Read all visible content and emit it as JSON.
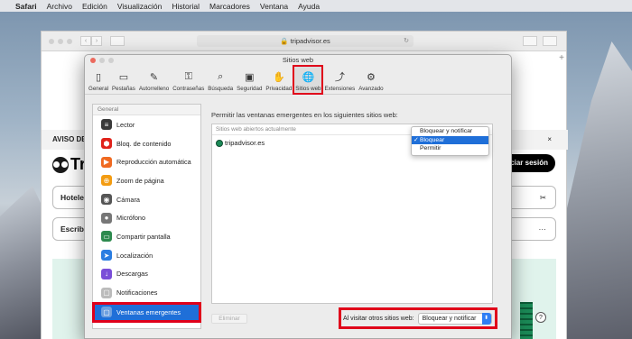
{
  "menubar": {
    "apple": "",
    "items": [
      "Safari",
      "Archivo",
      "Edición",
      "Visualización",
      "Historial",
      "Marcadores",
      "Ventana",
      "Ayuda"
    ]
  },
  "safari": {
    "url": "tripadvisor.es",
    "page": {
      "notice": "AVISO DE",
      "notice_close": "×",
      "brand": "Tri",
      "login": "ciar sesión",
      "search1": "Hotele",
      "search2": "Escribe",
      "search1_icon": "✂",
      "search2_icon": "···",
      "help": "?"
    }
  },
  "prefs": {
    "title": "Sitios web",
    "toolbar": [
      {
        "label": "General",
        "icon": "▯"
      },
      {
        "label": "Pestañas",
        "icon": "▭"
      },
      {
        "label": "Autorrelleno",
        "icon": "✎"
      },
      {
        "label": "Contraseñas",
        "icon": "⚿"
      },
      {
        "label": "Búsqueda",
        "icon": "⌕"
      },
      {
        "label": "Seguridad",
        "icon": "▣"
      },
      {
        "label": "Privacidad",
        "icon": "✋"
      },
      {
        "label": "Sitios web",
        "icon": "🌐"
      },
      {
        "label": "Extensiones",
        "icon": "⤴"
      },
      {
        "label": "Avanzado",
        "icon": "⚙"
      }
    ],
    "sidebar_header": "General",
    "sidebar_items": [
      {
        "label": "Lector",
        "icon": "≡",
        "color": "#3a3a3a"
      },
      {
        "label": "Bloq. de contenido",
        "icon": "⬢",
        "color": "#e0231b"
      },
      {
        "label": "Reproducción automática",
        "icon": "▶",
        "color": "#f06a21"
      },
      {
        "label": "Zoom de página",
        "icon": "⊕",
        "color": "#f39c12"
      },
      {
        "label": "Cámara",
        "icon": "◉",
        "color": "#555555"
      },
      {
        "label": "Micrófono",
        "icon": "●",
        "color": "#777777"
      },
      {
        "label": "Compartir pantalla",
        "icon": "▭",
        "color": "#2d8a4e"
      },
      {
        "label": "Localización",
        "icon": "➤",
        "color": "#2a7de1"
      },
      {
        "label": "Descargas",
        "icon": "↓",
        "color": "#7a4ed8"
      },
      {
        "label": "Notificaciones",
        "icon": "▢",
        "color": "#bbbbbb"
      },
      {
        "label": "Ventanas emergentes",
        "icon": "▢",
        "color": "#6fa1e0"
      }
    ],
    "main": {
      "label": "Permitir las ventanas emergentes en los siguientes sitios web:",
      "open_sites_header": "Sitios web abiertos actualmente",
      "site": "tripadvisor.es",
      "dropdown_options": [
        "Bloquear y notificar",
        "Bloquear",
        "Permitir"
      ],
      "dropdown_selected": "Bloquear",
      "check": "✓",
      "remove_button": "Eliminar",
      "visit_label": "Al visitar otros sitios web:",
      "visit_value": "Bloquear y notificar",
      "select_arrow": "⬍"
    }
  }
}
